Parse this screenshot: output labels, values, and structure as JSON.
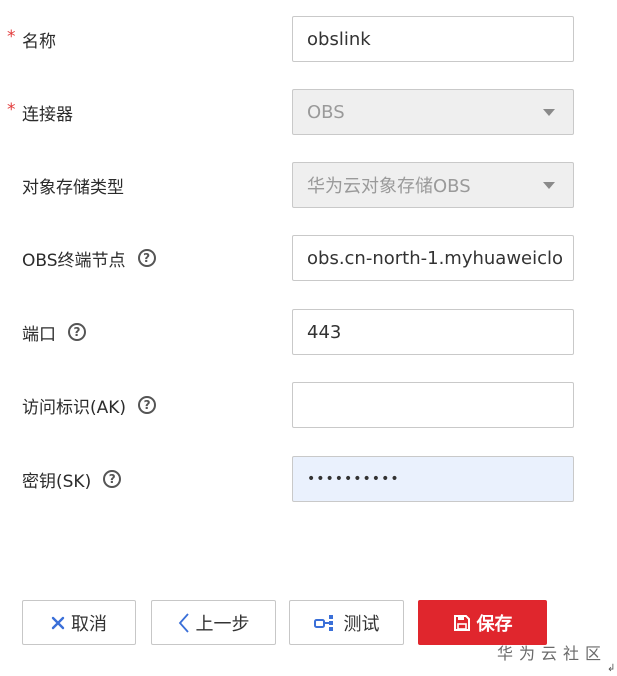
{
  "form": {
    "name": {
      "label": "名称",
      "required_mark": "*",
      "value": "obslink"
    },
    "connector": {
      "label": "连接器",
      "required_mark": "*",
      "value": "OBS"
    },
    "storage_type": {
      "label": "对象存储类型",
      "value": "华为云对象存储OBS"
    },
    "endpoint": {
      "label": "OBS终端节点",
      "help": "?",
      "value": "obs.cn-north-1.myhuaweiclo"
    },
    "port": {
      "label": "端口",
      "help": "?",
      "value": "443"
    },
    "access_key": {
      "label": "访问标识(AK)",
      "help": "?",
      "value": ""
    },
    "secret_key": {
      "label": "密钥(SK)",
      "help": "?",
      "value": "••••••••••"
    }
  },
  "buttons": {
    "cancel": "取消",
    "prev": "上一步",
    "test": "测试",
    "save": "保存"
  },
  "watermark": "华为云社区",
  "icons": {
    "cancel": "close-icon",
    "prev": "chevron-left-icon",
    "test": "link-test-icon",
    "save": "save-icon",
    "help": "question-circle-icon",
    "dropdown": "caret-down-icon"
  },
  "colors": {
    "required": "#e23b3b",
    "primary": "#e0262d",
    "accent": "#3a6fd8",
    "disabled_bg": "#efefef",
    "password_bg": "#eaf1fd"
  }
}
